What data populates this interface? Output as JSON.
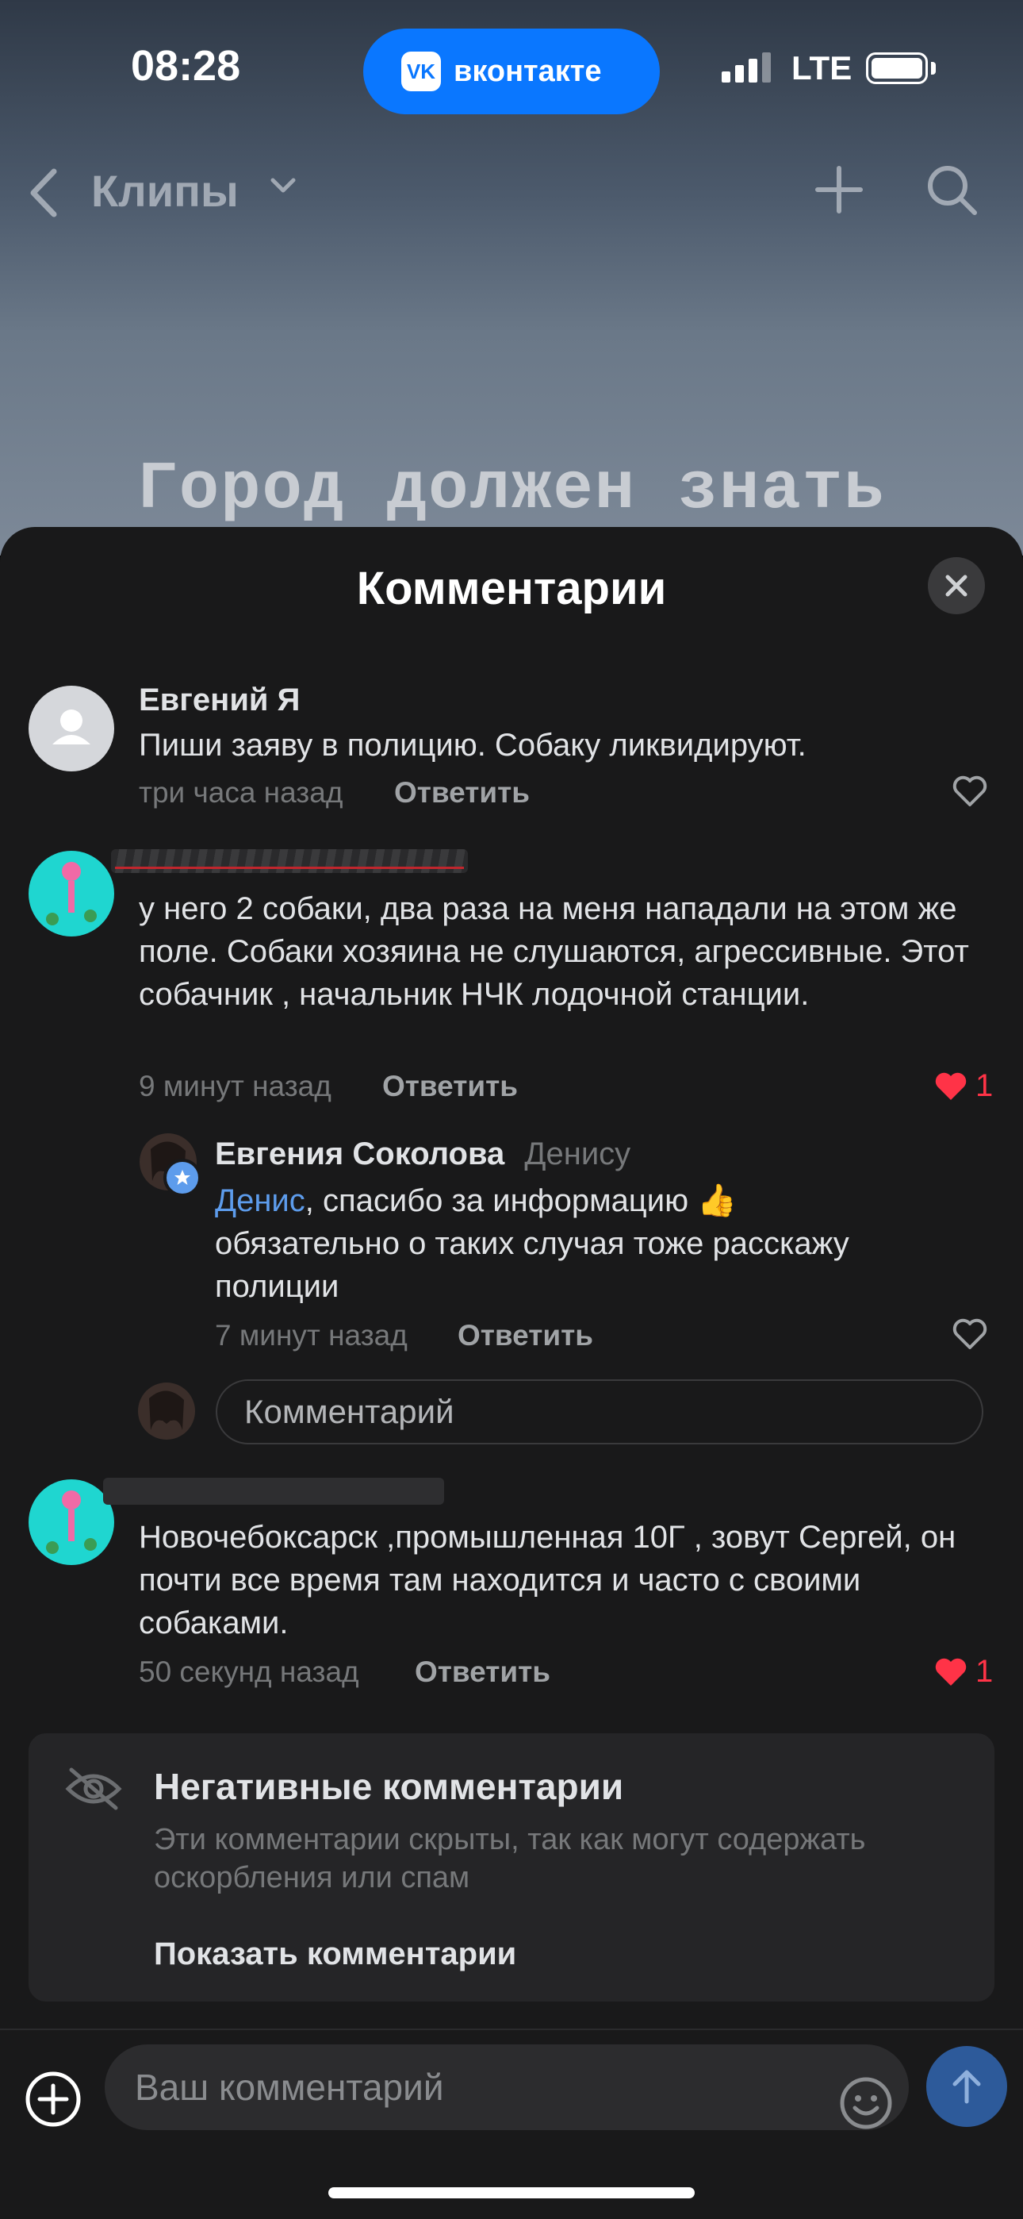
{
  "status_bar": {
    "time": "08:28",
    "pill_label": "вконтакте",
    "pill_logo": "VK",
    "network": "LTE"
  },
  "nav": {
    "title": "Клипы"
  },
  "video": {
    "overlay_text": "Город должен знать"
  },
  "sheet": {
    "title": "Комментарии"
  },
  "comments": [
    {
      "author": "Евгений Я",
      "text": "Пиши заяву в полицию. Собаку ликвидируют.",
      "time": "три часа назад",
      "reply_label": "Ответить",
      "likes": ""
    },
    {
      "author": "",
      "text": "у него 2 собаки, два раза на меня нападали на этом же поле. Собаки хозяина не слушаются, агрессивные. Этот собачник , начальник НЧК лодочной станции.",
      "time": "9 минут назад",
      "reply_label": "Ответить",
      "likes": "1"
    },
    {
      "author": "Евгения Соколова",
      "to": "Денису",
      "mention": "Денис",
      "text": ", спасибо за информацию 👍 обязательно о таких случая тоже расскажу полиции",
      "time": "7 минут назад",
      "reply_label": "Ответить",
      "likes": ""
    },
    {
      "author": "",
      "text": "Новочебоксарск ,промышленная 10Г , зовут Сергей, он почти все время там находится и часто с своими собаками.",
      "time": "50 секунд назад",
      "reply_label": "Ответить",
      "likes": "1"
    }
  ],
  "thread_input": {
    "placeholder": "Комментарий"
  },
  "negative": {
    "title": "Негативные комментарии",
    "description": "Эти комментарии скрыты, так как могут содержать оскорбления или спам",
    "show_label": "Показать комментарии"
  },
  "composer": {
    "placeholder": "Ваш комментарий"
  },
  "colors": {
    "accent": "#0a77ff",
    "like": "#ff3347",
    "sheet_bg": "#19191a",
    "mention": "#5d9cec"
  }
}
